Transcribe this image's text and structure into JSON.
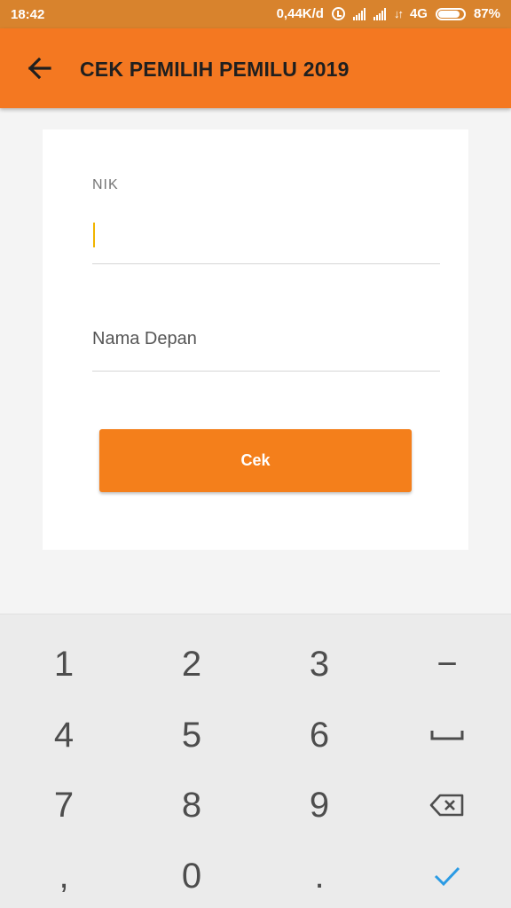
{
  "status_bar": {
    "time": "18:42",
    "network_speed": "0,44K/d",
    "network_type": "4G",
    "battery_percent": "87%",
    "battery_level": 0.87,
    "icons": [
      "alarm-icon",
      "signal-icon",
      "signal-icon",
      "data-arrows-icon",
      "battery-icon"
    ]
  },
  "app_bar": {
    "title": "CEK PEMILIH PEMILU 2019",
    "back_icon": "arrow-left-icon",
    "color": "#f47821"
  },
  "form": {
    "nik_label": "NIK",
    "nik_value": "",
    "nama_placeholder": "Nama Depan",
    "nama_value": "",
    "submit_label": "Cek",
    "accent_color": "#f47f1b"
  },
  "keyboard": {
    "keys": [
      {
        "label": "1",
        "name": "key-1"
      },
      {
        "label": "2",
        "name": "key-2"
      },
      {
        "label": "3",
        "name": "key-3"
      },
      {
        "label": "−",
        "name": "key-minus"
      },
      {
        "label": "4",
        "name": "key-4"
      },
      {
        "label": "5",
        "name": "key-5"
      },
      {
        "label": "6",
        "name": "key-6"
      },
      {
        "label": "",
        "name": "key-space",
        "icon": "space-icon"
      },
      {
        "label": "7",
        "name": "key-7"
      },
      {
        "label": "8",
        "name": "key-8"
      },
      {
        "label": "9",
        "name": "key-9"
      },
      {
        "label": "",
        "name": "key-backspace",
        "icon": "backspace-icon"
      },
      {
        "label": ",",
        "name": "key-comma"
      },
      {
        "label": "0",
        "name": "key-0"
      },
      {
        "label": ".",
        "name": "key-period"
      },
      {
        "label": "",
        "name": "key-done",
        "icon": "checkmark-icon"
      }
    ]
  }
}
